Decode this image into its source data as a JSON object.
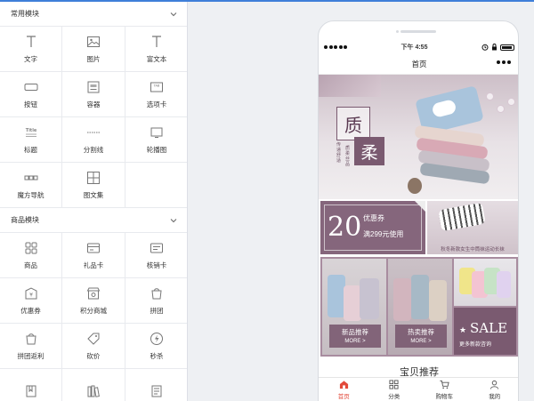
{
  "panel": {
    "sections": [
      {
        "title": "常用模块",
        "items": [
          {
            "label": "文字",
            "icon": "text-icon"
          },
          {
            "label": "图片",
            "icon": "image-icon"
          },
          {
            "label": "富文本",
            "icon": "rich-text-icon"
          },
          {
            "label": "按钮",
            "icon": "button-icon"
          },
          {
            "label": "容器",
            "icon": "container-icon"
          },
          {
            "label": "选项卡",
            "icon": "tab-icon"
          },
          {
            "label": "标题",
            "icon": "title-icon"
          },
          {
            "label": "分割线",
            "icon": "divider-icon"
          },
          {
            "label": "轮播图",
            "icon": "carousel-icon"
          },
          {
            "label": "魔方导航",
            "icon": "cube-nav-icon"
          },
          {
            "label": "图文集",
            "icon": "image-text-icon"
          }
        ]
      },
      {
        "title": "商品模块",
        "items": [
          {
            "label": "商品",
            "icon": "product-icon"
          },
          {
            "label": "礼品卡",
            "icon": "gift-card-icon"
          },
          {
            "label": "核销卡",
            "icon": "redeem-card-icon"
          },
          {
            "label": "优惠券",
            "icon": "coupon-icon"
          },
          {
            "label": "积分商城",
            "icon": "points-mall-icon"
          },
          {
            "label": "拼团",
            "icon": "group-buy-icon"
          },
          {
            "label": "拼团返利",
            "icon": "group-rebate-icon"
          },
          {
            "label": "砍价",
            "icon": "bargain-icon"
          },
          {
            "label": "秒杀",
            "icon": "flash-sale-icon"
          },
          {
            "label": "",
            "icon": "book-icon"
          },
          {
            "label": "",
            "icon": "library-icon"
          },
          {
            "label": "",
            "icon": "document-icon"
          }
        ]
      }
    ]
  },
  "phone": {
    "status": {
      "time": "下午 4:55"
    },
    "nav_title": "首页",
    "banner": {
      "char1": "质",
      "char2": "柔",
      "side_text": "传递舒适",
      "vertical_text": "质柔丝品",
      "tag": "丝品"
    },
    "coupon": {
      "amount": "20",
      "title": "优惠券",
      "desc": "满299元使用"
    },
    "promo_caption": "秋冬新款女生中筒袜运动长袜",
    "tiles": {
      "new": {
        "title": "新品推荐",
        "more": "MORE >"
      },
      "hot": {
        "title": "热卖推荐",
        "more": "MORE >"
      },
      "sale": {
        "title": "SALE",
        "sub": "更多新款咨询"
      }
    },
    "shop_title": "宝贝推荐",
    "tabbar": [
      {
        "label": "首页",
        "icon": "home-icon",
        "active": true
      },
      {
        "label": "分类",
        "icon": "category-icon",
        "active": false
      },
      {
        "label": "购物车",
        "icon": "cart-icon",
        "active": false
      },
      {
        "label": "我的",
        "icon": "user-icon",
        "active": false
      }
    ],
    "colors": {
      "accent": "#e24a3b",
      "theme": "#7a5a70"
    }
  }
}
